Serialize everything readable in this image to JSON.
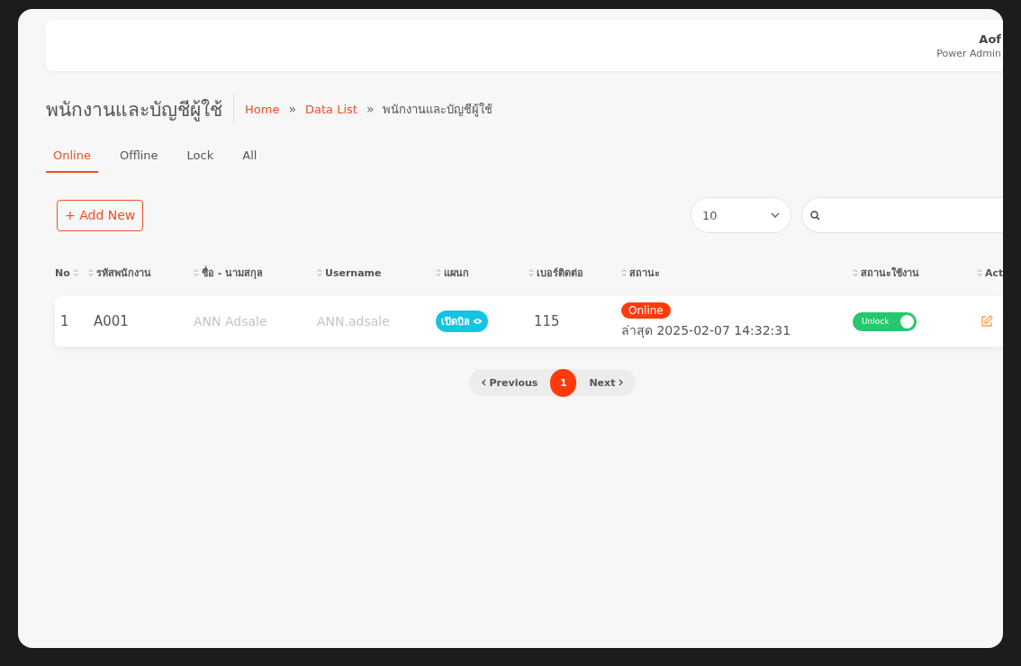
{
  "header": {
    "user_name": "Aof",
    "user_role": "Power Admin"
  },
  "page_title": "พนักงานและบัญชีผู้ใช้",
  "breadcrumb": {
    "separator": "»",
    "items": [
      {
        "label": "Home",
        "link": true
      },
      {
        "label": "Data List",
        "link": true
      },
      {
        "label": "พนักงานและบัญชีผู้ใช้",
        "link": false
      }
    ]
  },
  "tabs": [
    {
      "label": "Online",
      "selected": true
    },
    {
      "label": "Offline",
      "selected": false
    },
    {
      "label": "Lock",
      "selected": false
    },
    {
      "label": "All",
      "selected": false
    }
  ],
  "add_button": "+ Add New",
  "page_size": "10",
  "table": {
    "columns": [
      "No",
      "รหัสพนักงาน",
      "ชื่อ - นามสกุล",
      "Username",
      "แผนก",
      "เบอร์ติดต่อ",
      "สถานะ",
      "สถานะใช้งาน",
      "Act"
    ],
    "rows": [
      {
        "no": "1",
        "code": "A001",
        "name": "ANN Adsale",
        "username": "ANN.adsale",
        "department": "เปิดบิล",
        "phone": "115",
        "status": "Online",
        "last_seen": "ล่าสุด 2025-02-07 14:32:31",
        "lock_label": "Unlock",
        "unlocked": true
      }
    ]
  },
  "pagination": {
    "previous": "Previous",
    "next": "Next",
    "pages": [
      {
        "label": "1",
        "selected": true
      }
    ]
  }
}
